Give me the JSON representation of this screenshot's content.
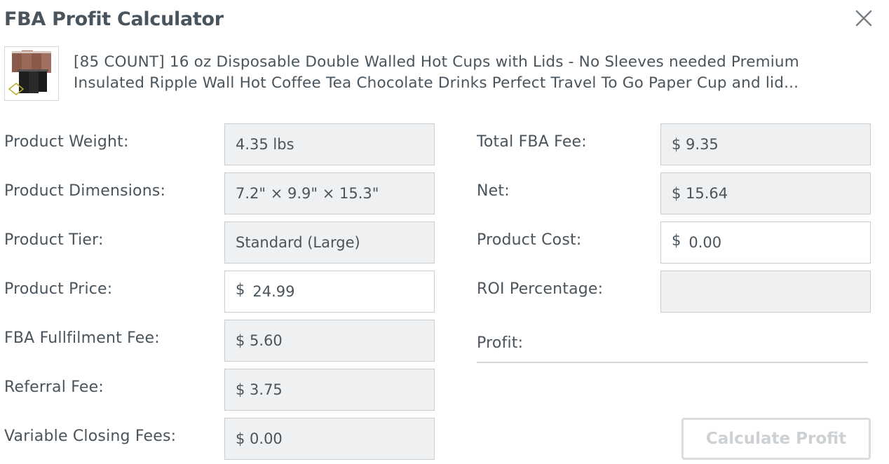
{
  "dialog": {
    "title": "FBA Profit Calculator",
    "close_icon": "close-icon"
  },
  "product": {
    "image_icon": "product-thumbnail",
    "title": "[85 COUNT] 16 oz Disposable Double Walled Hot Cups with Lids - No Sleeves needed Premium Insulated Ripple Wall Hot Coffee Tea Chocolate Drinks Perfect Travel To Go Paper Cup and lid..."
  },
  "left_fields": {
    "weight": {
      "label": "Product Weight:",
      "value": "4.35 lbs"
    },
    "dimensions": {
      "label": "Product Dimensions:",
      "value": "7.2\" × 9.9\" × 15.3\""
    },
    "tier": {
      "label": "Product Tier:",
      "value": "Standard (Large)"
    },
    "price": {
      "label": "Product Price:",
      "currency": "$",
      "value": "24.99"
    },
    "fulfilment_fee": {
      "label": "FBA Fullfilment Fee:",
      "value": "$ 5.60"
    },
    "referral_fee": {
      "label": "Referral Fee:",
      "value": "$ 3.75"
    },
    "closing_fees": {
      "label": "Variable Closing Fees:",
      "value": "$ 0.00"
    }
  },
  "right_fields": {
    "total_fba_fee": {
      "label": "Total FBA Fee:",
      "value": "$ 9.35"
    },
    "net": {
      "label": "Net:",
      "value": "$ 15.64"
    },
    "product_cost": {
      "label": "Product Cost:",
      "currency": "$",
      "value": "0.00"
    },
    "roi": {
      "label": "ROI Percentage:",
      "value": ""
    },
    "profit": {
      "label": "Profit:",
      "value": ""
    }
  },
  "actions": {
    "calculate_label": "Calculate Profit"
  }
}
